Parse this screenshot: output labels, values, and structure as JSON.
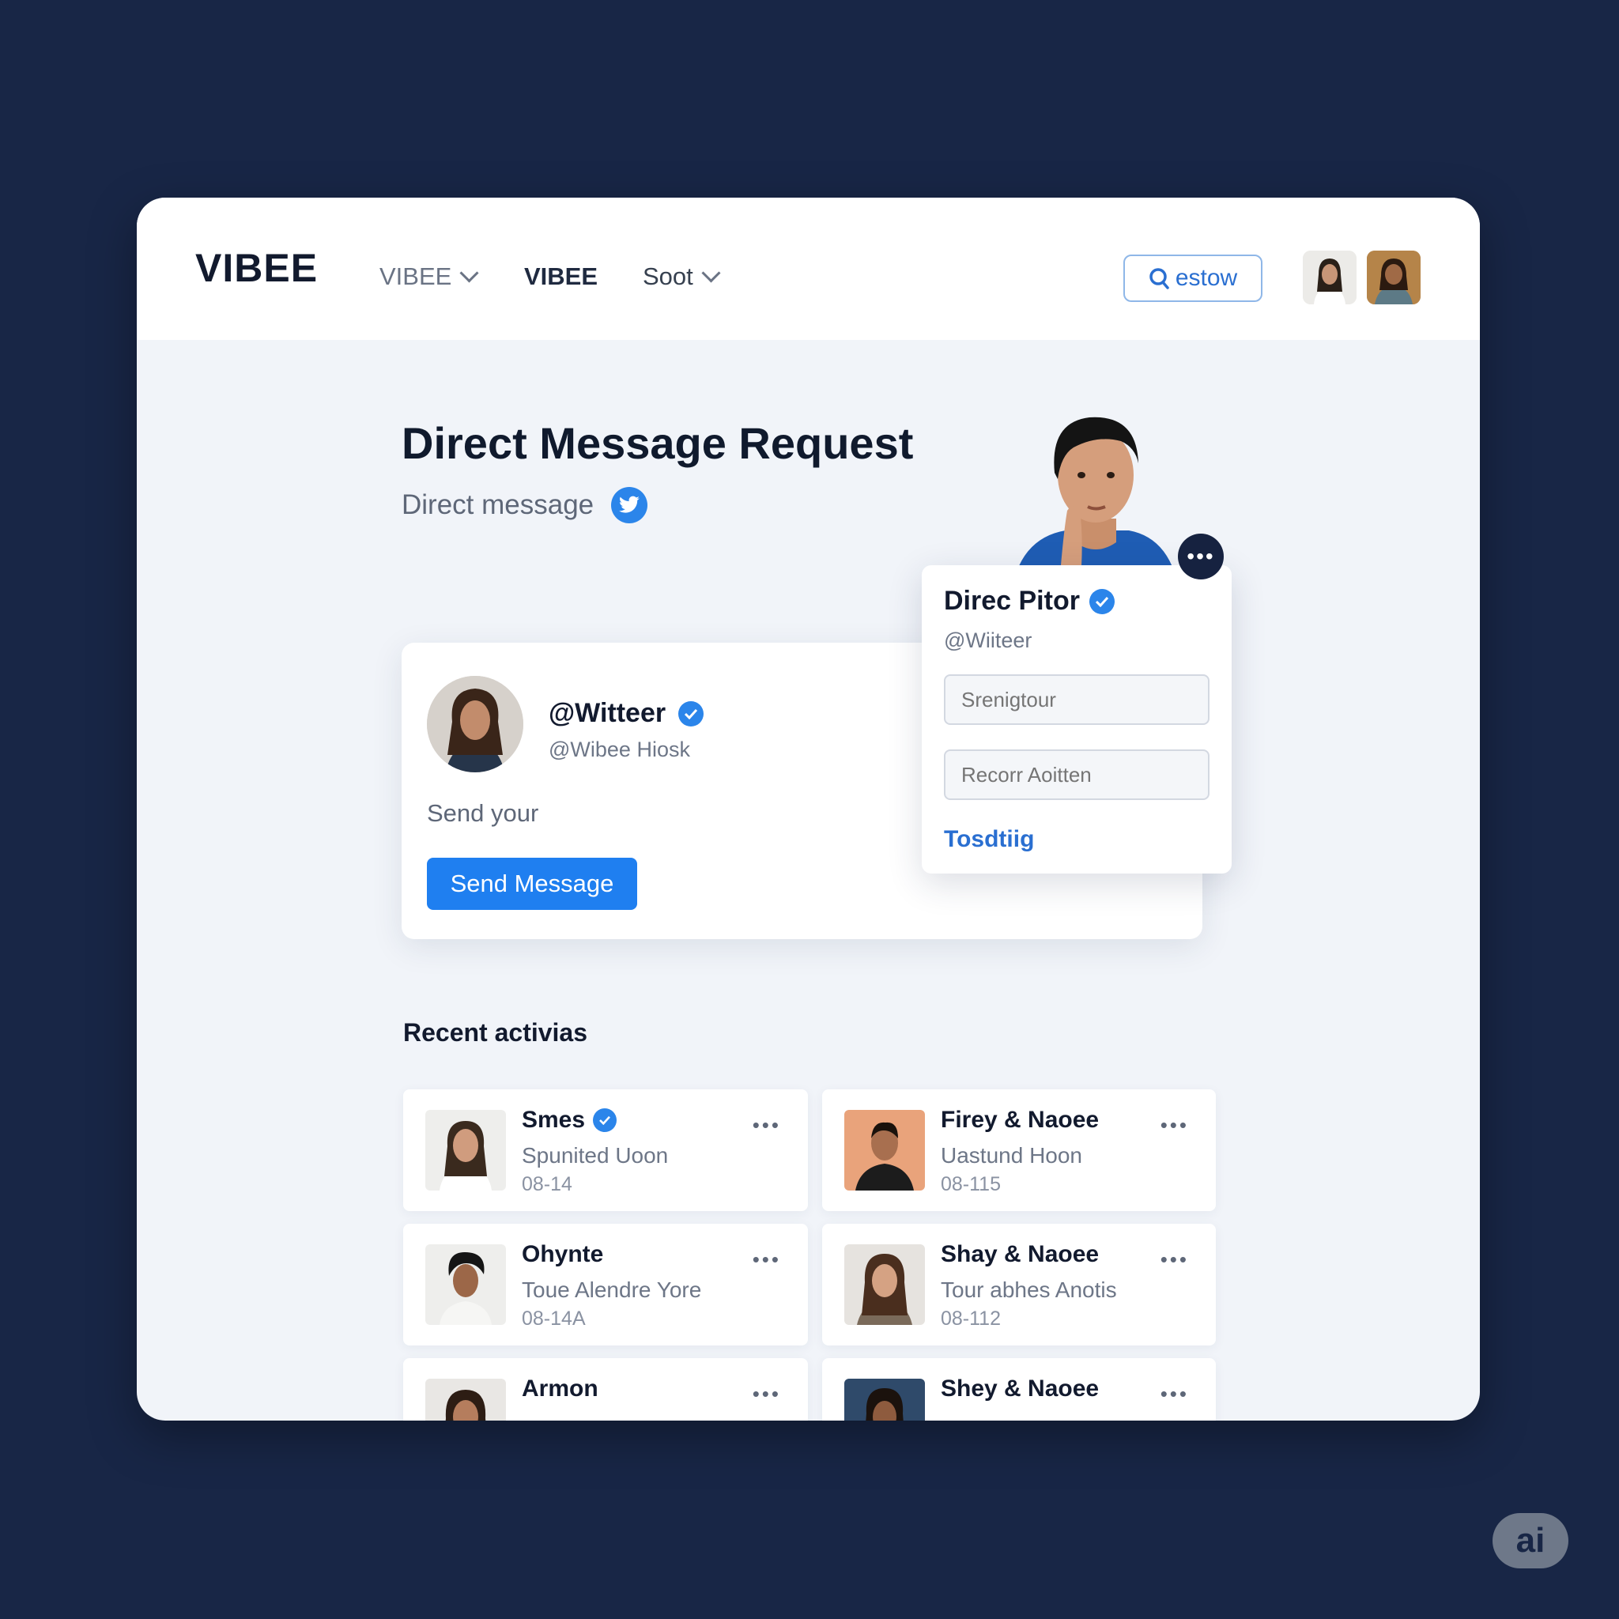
{
  "header": {
    "logo": "VIBEE",
    "nav": [
      {
        "label": "VIBEE",
        "has_dropdown": true
      },
      {
        "label": "VIBEE",
        "has_dropdown": false
      },
      {
        "label": "Soot",
        "has_dropdown": true
      }
    ],
    "search_label": "estow"
  },
  "page": {
    "title": "Direct Message Request",
    "subtitle": "Direct message"
  },
  "request_card": {
    "handle": "@Witteer",
    "sub": "@Wibee Hiosk",
    "prompt": "Send your",
    "button": "Send Message"
  },
  "profile_popup": {
    "name": "Direc Pitor",
    "handle": "@Wiiteer",
    "input1_placeholder": "Srenigtour",
    "input2_placeholder": "Recorr Aoitten",
    "link": "Tosdtiig",
    "more": "•••"
  },
  "recent": {
    "title": "Recent activias",
    "items": [
      {
        "name": "Smes",
        "verified": true,
        "desc": "Spunited Uoon",
        "date": "08-14",
        "more": "•••"
      },
      {
        "name": "Firey & Naoee",
        "verified": false,
        "desc": "Uastund Hoon",
        "date": "08-115",
        "more": "•••"
      },
      {
        "name": "Ohynte",
        "verified": false,
        "desc": "Toue Alendre Yore",
        "date": "08-14A",
        "more": "•••"
      },
      {
        "name": "Shay & Naoee",
        "verified": false,
        "desc": "Tour abhes Anotis",
        "date": "08-112",
        "more": "•••"
      },
      {
        "name": "Armon",
        "verified": false,
        "desc": "",
        "date": "",
        "more": "•••"
      },
      {
        "name": "Shey & Naoee",
        "verified": false,
        "desc": "",
        "date": "",
        "more": "•••"
      }
    ]
  },
  "corner_badge": "ai",
  "colors": {
    "background": "#182646",
    "accent": "#1f7ff0",
    "verified": "#2b85ea"
  }
}
